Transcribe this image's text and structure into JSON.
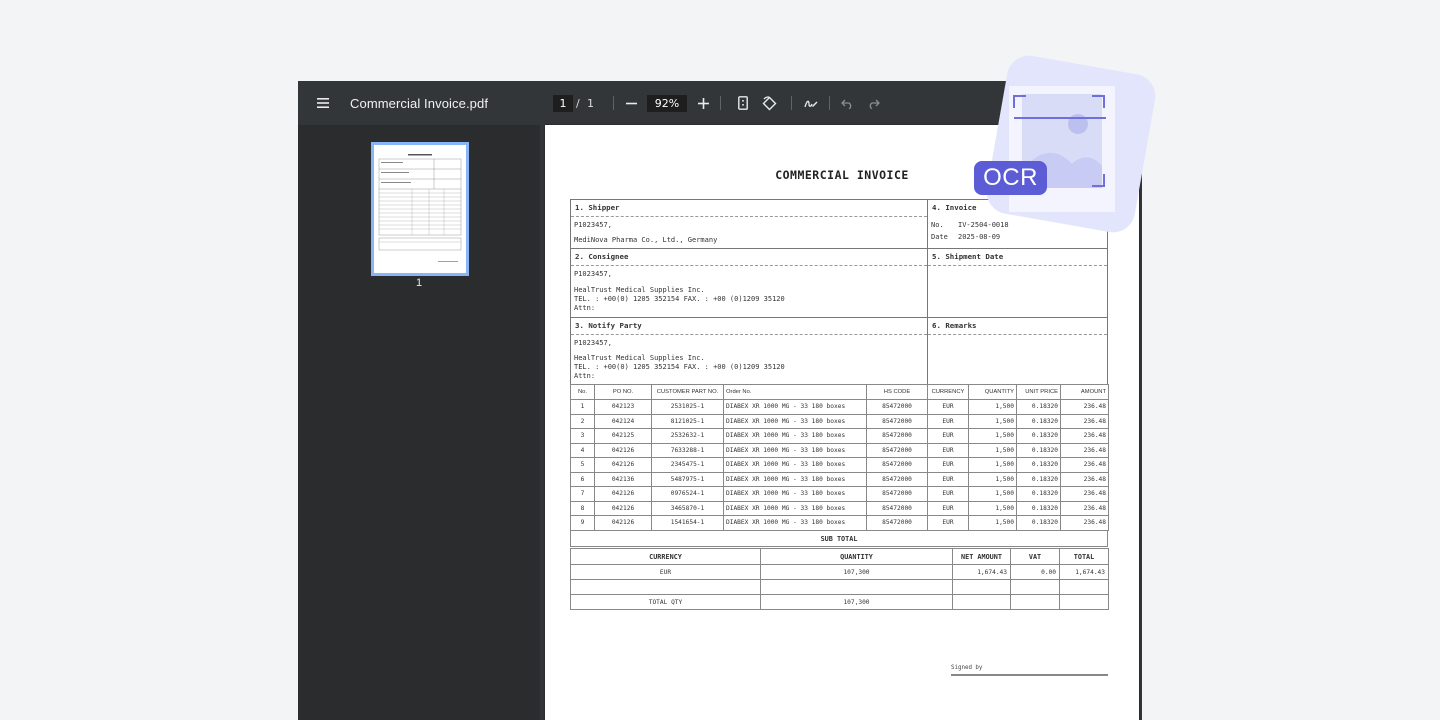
{
  "toolbar": {
    "menu_icon": "menu-icon",
    "title": "Commercial Invoice.pdf",
    "current_page": "1",
    "page_separator": "/",
    "total_pages": "1",
    "zoom": "92%"
  },
  "sidebar": {
    "thumbnail_label": "1"
  },
  "invoice": {
    "title": "COMMERCIAL INVOICE",
    "shipper": {
      "heading": "1. Shipper",
      "line1": "P1023457,",
      "line2": "MediNova Pharma Co., Ltd., Germany"
    },
    "invoice": {
      "heading": "4. Invoice",
      "no_label": "No.",
      "no_value": "IV-2504-0018",
      "date_label": "Date",
      "date_value": "2025-08-09"
    },
    "consignee": {
      "heading": "2. Consignee",
      "line1": "P1023457,",
      "line2": "HealTrust Medical Supplies Inc.",
      "line3": "TEL. : +00(0) 1205 352154 FAX. : +00 (0)1209 35120",
      "line4": "Attn:"
    },
    "shipment_date": {
      "heading": "5. Shipment Date"
    },
    "notify": {
      "heading": "3. Notify Party",
      "line1": "P1023457,",
      "line2": "HealTrust Medical Supplies Inc.",
      "line3": "TEL. : +00(0) 1205 352154 FAX. : +00 (0)1209 35120",
      "line4": "Attn:"
    },
    "remarks": {
      "heading": "6. Remarks"
    },
    "columns": [
      "No.",
      "PO NO.",
      "CUSTOMER PART NO.",
      "Order No.",
      "HS CODE",
      "CURRENCY",
      "QUANTITY",
      "UNIT PRICE",
      "AMOUNT"
    ],
    "rows": [
      [
        "1",
        "042123",
        "2531025-1",
        "DIABEX XR 1000 MG - 33 180 boxes",
        "85472000",
        "EUR",
        "1,500",
        "0.18320",
        "236.48"
      ],
      [
        "2",
        "042124",
        "8121025-1",
        "DIABEX XR 1000 MG - 33 180 boxes",
        "85472000",
        "EUR",
        "1,500",
        "0.18320",
        "236.48"
      ],
      [
        "3",
        "042125",
        "2532632-1",
        "DIABEX XR 1000 MG - 33 180 boxes",
        "85472000",
        "EUR",
        "1,500",
        "0.18320",
        "236.48"
      ],
      [
        "4",
        "042126",
        "7633288-1",
        "DIABEX XR 1000 MG - 33 180 boxes",
        "85472000",
        "EUR",
        "1,500",
        "0.18320",
        "236.48"
      ],
      [
        "5",
        "042126",
        "2345475-1",
        "DIABEX XR 1000 MG - 33 180 boxes",
        "85472000",
        "EUR",
        "1,500",
        "0.18320",
        "236.48"
      ],
      [
        "6",
        "042136",
        "5487975-1",
        "DIABEX XR 1000 MG - 33 180 boxes",
        "85472000",
        "EUR",
        "1,500",
        "0.18320",
        "236.48"
      ],
      [
        "7",
        "042126",
        "0976524-1",
        "DIABEX XR 1000 MG - 33 180 boxes",
        "85472000",
        "EUR",
        "1,500",
        "0.18320",
        "236.48"
      ],
      [
        "8",
        "042126",
        "3465870-1",
        "DIABEX XR 1000 MG - 33 180 boxes",
        "85472000",
        "EUR",
        "1,500",
        "0.18320",
        "236.48"
      ],
      [
        "9",
        "042126",
        "1541654-1",
        "DIABEX XR 1000 MG - 33 180 boxes",
        "85472000",
        "EUR",
        "1,500",
        "0.18320",
        "236.48"
      ]
    ],
    "subtotal_label": "SUB TOTAL",
    "totals_columns": [
      "CURRENCY",
      "QUANTITY",
      "NET AMOUNT",
      "VAT",
      "TOTAL"
    ],
    "totals_row": [
      "EUR",
      "107,300",
      "1,674.43",
      "0.00",
      "1,674.43"
    ],
    "total_qty_label": "TOTAL QTY",
    "total_qty_value": "107,300",
    "signed_by": "Signed by"
  },
  "badge": {
    "label": "OCR",
    "icon": "image-scan-icon"
  }
}
